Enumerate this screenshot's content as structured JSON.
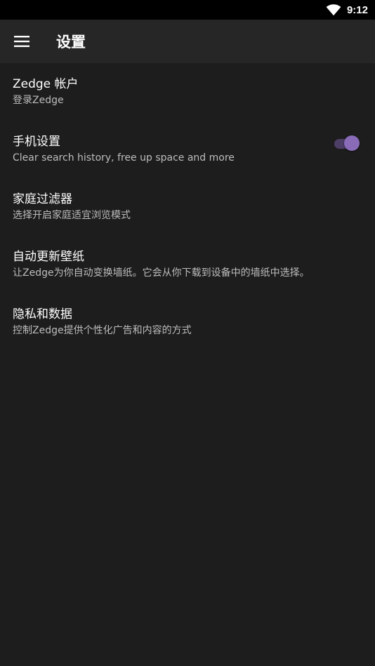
{
  "status_bar": {
    "time": "9:12",
    "wifi_icon": "wifi-icon"
  },
  "app_bar": {
    "menu_icon": "hamburger-menu-icon",
    "title": "设置"
  },
  "settings": [
    {
      "title": "Zedge 帐户",
      "subtitle": "登录Zedge"
    },
    {
      "title": "手机设置",
      "subtitle": "Clear search history, free up space and more"
    },
    {
      "title": "家庭过滤器",
      "subtitle": "选择开启家庭适宜浏览模式",
      "toggle": true
    },
    {
      "title": "自动更新壁纸",
      "subtitle": "让Zedge为你自动变换墙纸。它会从你下载到设备中的墙纸中选择。"
    },
    {
      "title": "隐私和数据",
      "subtitle": "控制Zedge提供个性化广告和内容的方式"
    }
  ],
  "colors": {
    "background": "#1d1d1d",
    "app_bar": "#262626",
    "status_bar": "#000000",
    "accent": "#8a6bb8",
    "toggle_track": "#4d3e66"
  }
}
